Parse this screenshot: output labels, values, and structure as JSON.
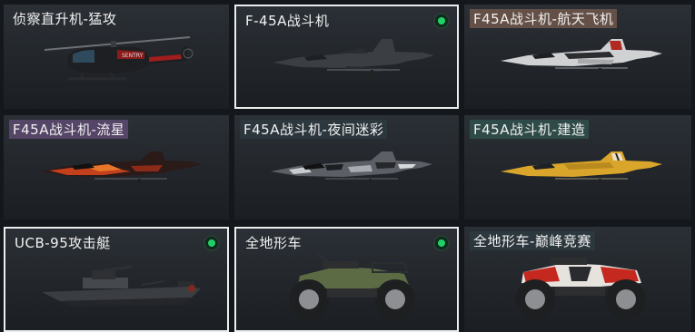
{
  "items": [
    {
      "label": "侦察直升机-猛攻",
      "equipped": false,
      "selected": false,
      "icon": "helicopter-icon"
    },
    {
      "label": "F-45A战斗机",
      "equipped": true,
      "selected": true,
      "icon": "fighter-jet-icon"
    },
    {
      "label": "F45A战斗机-航天飞机",
      "equipped": false,
      "selected": false,
      "icon": "fighter-jet-icon"
    },
    {
      "label": "F45A战斗机-流星",
      "equipped": false,
      "selected": false,
      "icon": "fighter-jet-icon"
    },
    {
      "label": "F45A战斗机-夜间迷彩",
      "equipped": false,
      "selected": false,
      "icon": "fighter-jet-icon"
    },
    {
      "label": "F45A战斗机-建造",
      "equipped": false,
      "selected": false,
      "icon": "fighter-jet-icon"
    },
    {
      "label": "UCB-95攻击艇",
      "equipped": true,
      "selected": true,
      "icon": "attack-boat-icon"
    },
    {
      "label": "全地形车",
      "equipped": true,
      "selected": true,
      "icon": "atv-icon"
    },
    {
      "label": "全地形车-巅峰竞赛",
      "equipped": false,
      "selected": false,
      "icon": "atv-icon"
    }
  ],
  "colors": {
    "equipped_indicator": "#22d06a",
    "selected_border": "#eceeee",
    "card_background": "#2b3036"
  }
}
